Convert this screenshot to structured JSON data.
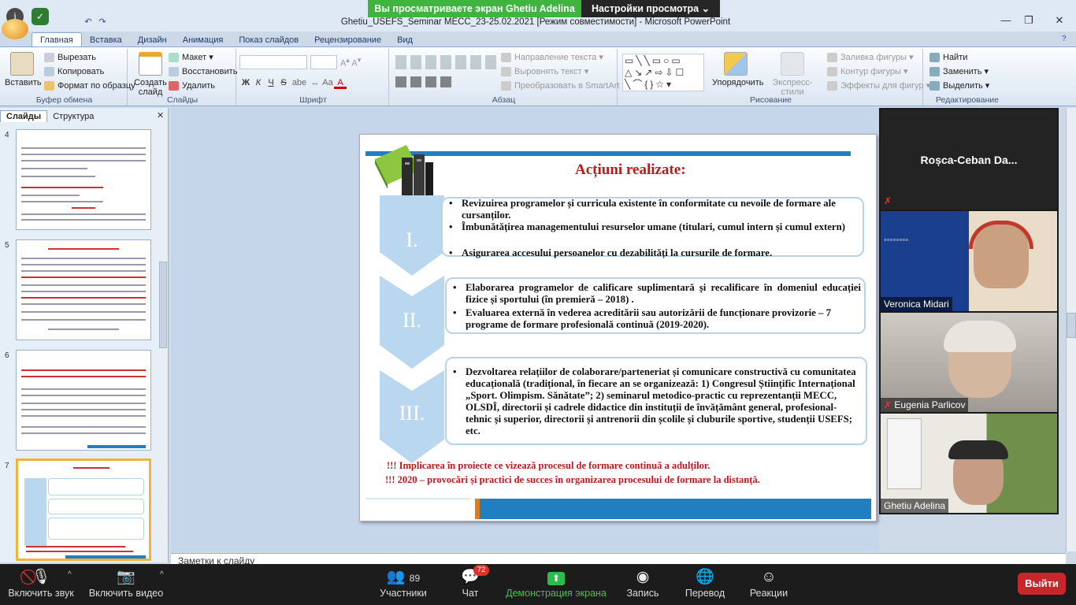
{
  "zoom": {
    "share_banner": "Вы просматриваете экран Ghetiu Adelina",
    "view_settings": "Настройки просмотра",
    "view_settings_chevron": "chevron-down-icon",
    "toolbar": {
      "mute": "Включить звук",
      "video": "Включить видео",
      "participants": "Участники",
      "participants_count": "89",
      "chat": "Чат",
      "chat_badge": "72",
      "share": "Демонстрация экрана",
      "record": "Запись",
      "translate": "Перевод",
      "reactions": "Реакции",
      "end": "Выйти"
    },
    "participants_list": [
      {
        "name": "Roșca-Ceban  Da...",
        "video": false
      },
      {
        "name": "Veronica Midari",
        "video": true
      },
      {
        "name": "Eugenia Parlicov",
        "video": true,
        "muted": true
      },
      {
        "name": "Ghetiu Adelina",
        "video": true
      }
    ],
    "colors": {
      "share_green": "#3fb53f",
      "end_red": "#c9262b",
      "toolbar_bg": "#1c1c1c"
    }
  },
  "ppt": {
    "app_title": "Ghetiu_USEFS_Seminar MECC_23-25.02.2021 [Режим совместимости] - Microsoft PowerPoint",
    "tabs": [
      "Главная",
      "Вставка",
      "Дизайн",
      "Анимация",
      "Показ слайдов",
      "Рецензирование",
      "Вид"
    ],
    "ribbon": {
      "clipboard": {
        "label": "Буфер обмена",
        "paste": "Вставить",
        "cut": "Вырезать",
        "copy": "Копировать",
        "format": "Формат по образцу"
      },
      "slides": {
        "label": "Слайды",
        "create": "Создать слайд",
        "layout": "Макет",
        "reset": "Восстановить",
        "delete": "Удалить"
      },
      "font": {
        "label": "Шрифт",
        "bold": "Ж",
        "italic": "К",
        "underline": "Ч",
        "strike": "S",
        "shadow": "abe"
      },
      "paragraph": {
        "label": "Абзац",
        "text_dir": "Направление текста",
        "align_text": "Выровнять текст",
        "smartart": "Преобразовать в SmartArt"
      },
      "drawing": {
        "label": "Рисование",
        "arrange": "Упорядочить",
        "quick_styles": "Экспресс-стили",
        "fill": "Заливка фигуры",
        "outline": "Контур фигуры",
        "effects": "Эффекты для фигур"
      },
      "editing": {
        "label": "Редактирование",
        "find": "Найти",
        "replace": "Заменить",
        "select": "Выделить"
      }
    },
    "panel_tabs": [
      "Слайды",
      "Структура"
    ],
    "slide_numbers": [
      "4",
      "5",
      "6",
      "7"
    ],
    "notes_placeholder": "Заметки к слайду",
    "slide": {
      "title": "Acțiuni  realizate:",
      "sections": [
        {
          "roman": "I.",
          "bullets": [
            "Revizuirea programelor și curricula existente în conformitate cu nevoile de formare ale cursanților.",
            "Îmbunătățirea managementului resurselor umane (titulari, cumul intern și cumul extern)",
            "Asigurarea accesului persoanelor cu dezabilități la cursurile de formare."
          ]
        },
        {
          "roman": "II.",
          "bullets": [
            "Elaborarea programelor de calificare suplimentară și recalificare în domeniul educației fizice și sportului (în premieră – 2018) .",
            "Evaluarea externă în vederea acreditării sau autorizării de funcționare provizorie – 7 programe de formare profesională continuă (2019-2020)."
          ]
        },
        {
          "roman": "III.",
          "bullets": [
            "Dezvoltarea relațiilor de colaborare/parteneriat și comunicare constructivă cu comunitatea educațională (tradițional, în fiecare an se organizează: 1) Congresul Științific Internațional „Sport. Olimpism. Sănătate”; 2) seminarul metodico-practic cu reprezentanții MECC, OLSDÎ,  directorii și cadrele didactice din instituții de învățământ general, profesional-tehnic și superior, directorii și antrenorii din școlile și cluburile sportive, studenții USEFS;  etc."
          ]
        }
      ],
      "footer_lines": [
        "!!! Implicarea în proiecte ce vizează procesul de formare continuă a adulților.",
        "!!! 2020 – provocări și practici de succes în organizarea  procesului de formare la distanță."
      ],
      "colors": {
        "title_red": "#c0191c",
        "chevron_blue": "#b9d7ee",
        "bar_blue": "#1f7fc1",
        "bar_orange": "#e07b21"
      }
    }
  }
}
